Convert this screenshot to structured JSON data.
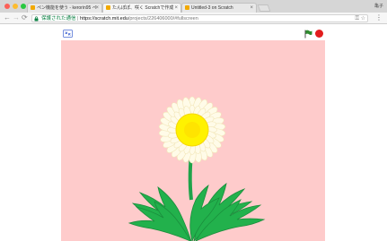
{
  "browser": {
    "tabs": [
      {
        "title": "ペン機能を使う - kerorin95 ペ",
        "favicon_color": "#f2a900",
        "active": false
      },
      {
        "title": "たんぽぽ、咲く Scratchで作成",
        "favicon_color": "#f2a900",
        "active": true
      },
      {
        "title": "Untitled-3 on Scratch",
        "favicon_color": "#f2a900",
        "active": false
      }
    ],
    "profile_name": "亀子",
    "secure_label": "保護された通信",
    "url_separator": "|",
    "url_host": "https://scratch.mit.edu",
    "url_path": "/projects/226406000/#fullscreen"
  },
  "player": {
    "flag_color": "#2e8b2e",
    "stop_color": "#e21d1d"
  },
  "stage": {
    "background": "#fecbcb",
    "flower": {
      "petal_color": "#fffbe8",
      "center_color": "#fff200",
      "stem_color": "#1fa34a",
      "leaf_color": "#22b14c"
    }
  }
}
